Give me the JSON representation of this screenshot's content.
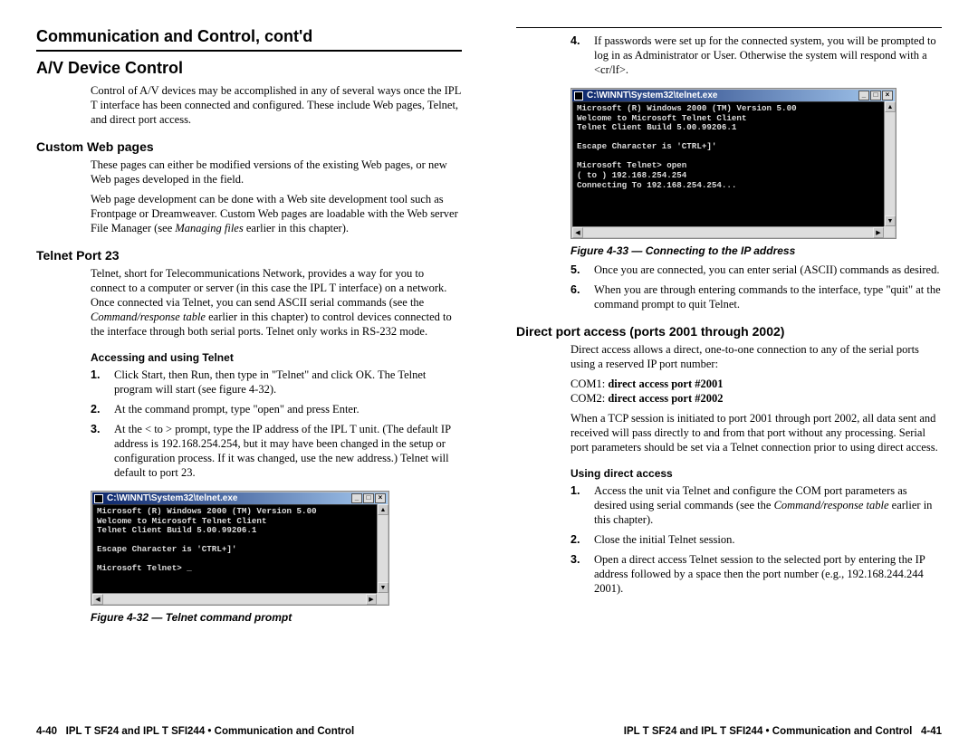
{
  "chapterTitle": "Communication and Control, cont'd",
  "left": {
    "h1": "A/V Device Control",
    "intro": "Control of A/V devices may be accomplished in any of several ways once the IPL T interface has been connected and configured.  These include Web pages, Telnet, and direct port access.",
    "customWeb": {
      "heading": "Custom Web pages",
      "p1": "These pages can either be modified versions of the existing Web pages, or new Web pages developed in the field.",
      "p2a": "Web page development can be done with a Web site development tool such as Frontpage or Dreamweaver.  Custom Web pages are loadable with the Web server File Manager (see ",
      "p2i": "Managing files",
      "p2b": " earlier in this chapter)."
    },
    "telnet": {
      "heading": "Telnet Port 23",
      "p1a": "Telnet, short for Telecommunications Network, provides a way for you to connect to a computer or server (in this case the IPL T interface) on a network.  Once connected via Telnet, you can send ASCII serial commands (see the ",
      "p1i": "Command/response table",
      "p1b": " earlier in this chapter) to control devices connected to the interface through both serial ports.  Telnet only works in RS-232 mode.",
      "subhead": "Accessing and using Telnet",
      "steps": [
        "Click Start, then Run, then type in \"Telnet\" and click OK.  The Telnet program will start (see figure 4-32).",
        "At the command prompt, type \"open\" and press Enter.",
        "At the < to > prompt, type the IP address of the IPL T unit. (The default IP address is 192.168.254.254, but it may have been changed in the setup or configuration process.  If it was changed, use the new address.)  Telnet will default to port 23."
      ],
      "terminal": {
        "title": "C:\\WINNT\\System32\\telnet.exe",
        "body": "Microsoft (R) Windows 2000 (TM) Version 5.00\nWelcome to Microsoft Telnet Client\nTelnet Client Build 5.00.99206.1\n\nEscape Character is 'CTRL+]'\n\nMicrosoft Telnet> _"
      },
      "figCaption": "Figure 4-32 — Telnet command prompt"
    }
  },
  "right": {
    "step4": "If passwords were set up for the connected system, you will be prompted to log in as Administrator or User.  Otherwise the system will respond with a <cr/lf>.",
    "terminal": {
      "title": "C:\\WINNT\\System32\\telnet.exe",
      "body": "Microsoft (R) Windows 2000 (TM) Version 5.00\nWelcome to Microsoft Telnet Client\nTelnet Client Build 5.00.99206.1\n\nEscape Character is 'CTRL+]'\n\nMicrosoft Telnet> open\n( to ) 192.168.254.254\nConnecting To 192.168.254.254..."
    },
    "figCaption": "Figure 4-33 — Connecting to the IP address",
    "step5": "Once you are connected, you can enter serial (ASCII) commands as desired.",
    "step6": "When you are through entering commands to the interface, type \"quit\" at the command prompt to quit Telnet.",
    "direct": {
      "heading": "Direct port access (ports 2001 through 2002)",
      "p1": "Direct access allows a direct, one-to-one connection to any of the serial ports using a reserved IP port number:",
      "com1a": "COM1: ",
      "com1b": "direct access port #2001",
      "com2a": "COM2: ",
      "com2b": "direct access port #2002",
      "p2": "When a TCP session is initiated to port 2001 through port 2002, all data sent and received will pass directly to and from that port without any processing.  Serial port parameters should be set via a Telnet connection prior to using direct access.",
      "subhead": "Using direct access",
      "steps": [
        {
          "a": "Access the unit via Telnet and configure the COM port parameters as desired using serial commands (see the ",
          "i": "Command/response table",
          "b": " earlier in this chapter)."
        },
        {
          "a": "Close the initial Telnet session.",
          "i": "",
          "b": ""
        },
        {
          "a": "Open a direct access Telnet session to the selected port by entering the IP address followed by a space then the port number (e.g., 192.168.244.244 2001).",
          "i": "",
          "b": ""
        }
      ]
    }
  },
  "footer": {
    "leftPageNum": "4-40",
    "leftText": "IPL T SF24 and IPL T SFI244 • Communication and Control",
    "rightText": "IPL T SF24 and IPL T SFI244 • Communication and Control",
    "rightPageNum": "4-41"
  }
}
